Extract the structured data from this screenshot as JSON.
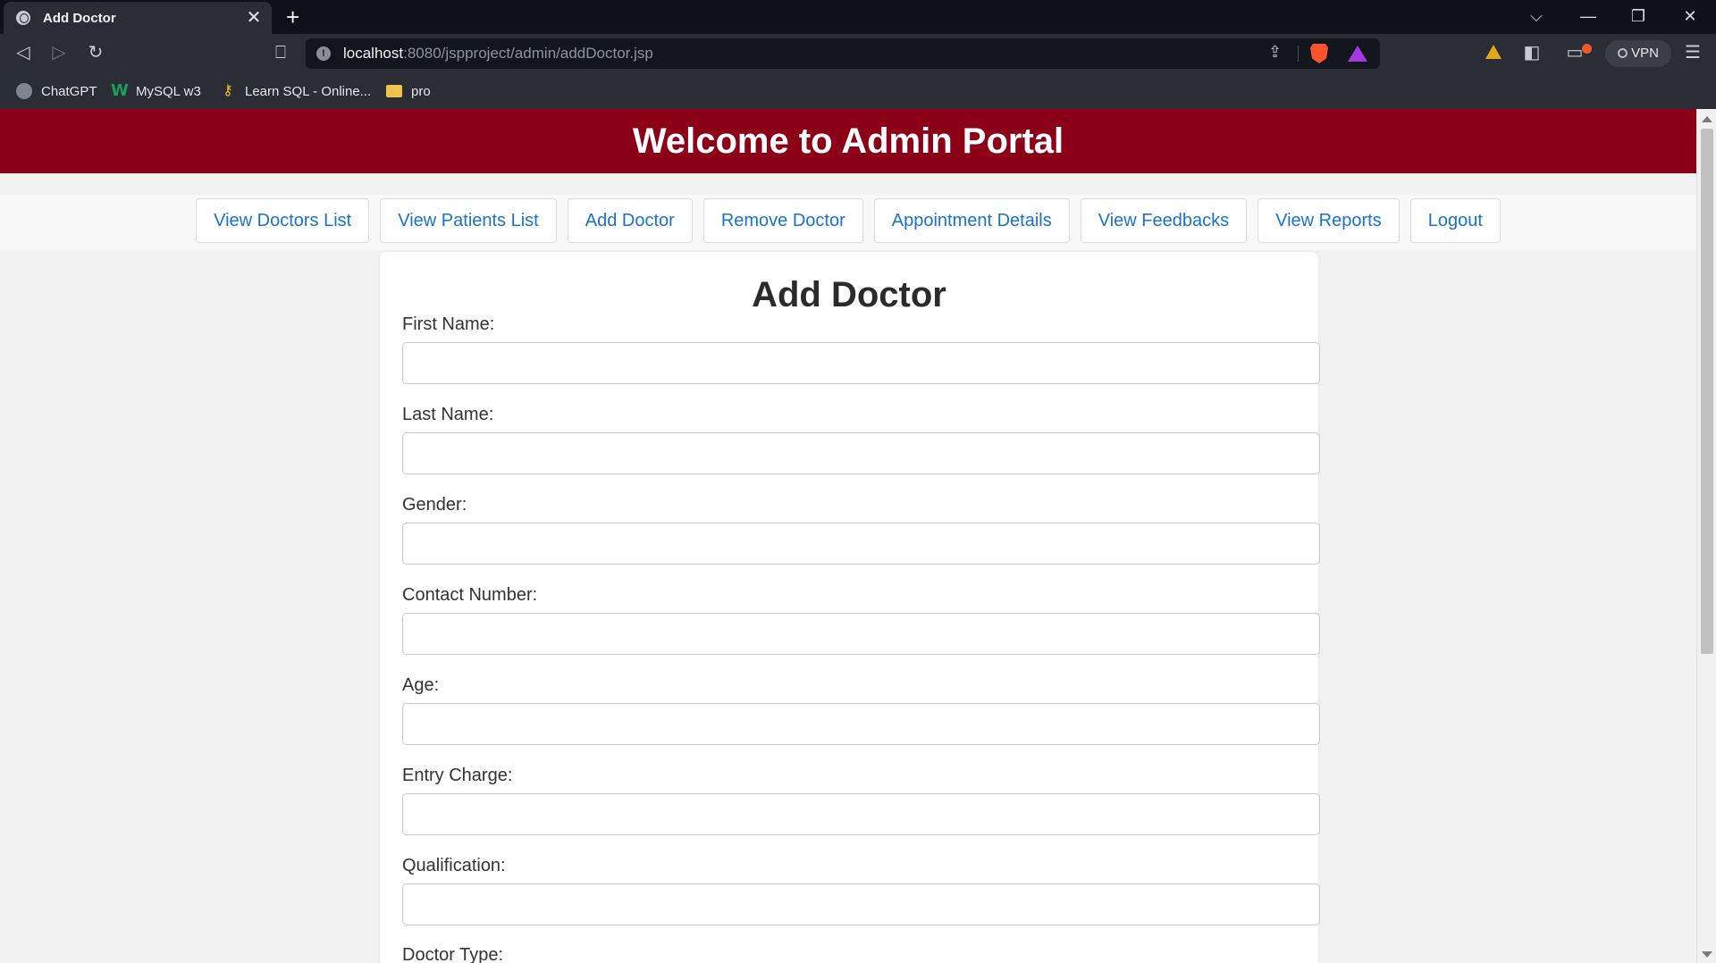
{
  "browser": {
    "tab_title": "Add Doctor",
    "tab_close": "✕",
    "new_tab": "+",
    "url_host": "localhost",
    "url_path": ":8080/jspproject/admin/addDoctor.jsp",
    "vpn_label": "VPN",
    "bookmarks": [
      {
        "label": "ChatGPT",
        "icon": "chatgpt-icon"
      },
      {
        "label": "MySQL w3",
        "icon": "w3schools-icon"
      },
      {
        "label": "Learn SQL - Online...",
        "icon": "key-icon"
      },
      {
        "label": "pro",
        "icon": "folder-icon"
      }
    ],
    "window_controls": {
      "dropdown": "⌵",
      "minimize": "—",
      "restore": "❐",
      "close": "✕"
    }
  },
  "header": {
    "title": "Welcome to Admin Portal"
  },
  "nav": {
    "items": [
      "View Doctors List",
      "View Patients List",
      "Add Doctor",
      "Remove Doctor",
      "Appointment Details",
      "View Feedbacks",
      "View Reports",
      "Logout"
    ]
  },
  "form": {
    "title": "Add Doctor",
    "fields": [
      {
        "label": "First Name:",
        "value": ""
      },
      {
        "label": "Last Name:",
        "value": ""
      },
      {
        "label": "Gender:",
        "value": ""
      },
      {
        "label": "Contact Number:",
        "value": ""
      },
      {
        "label": "Age:",
        "value": ""
      },
      {
        "label": "Entry Charge:",
        "value": ""
      },
      {
        "label": "Qualification:",
        "value": ""
      },
      {
        "label": "Doctor Type:"
      }
    ]
  },
  "colors": {
    "header_bg": "#8b0017",
    "link": "#1a73c9",
    "page_bg": "#f2f2f2",
    "browser_chrome": "#2a2d36"
  }
}
